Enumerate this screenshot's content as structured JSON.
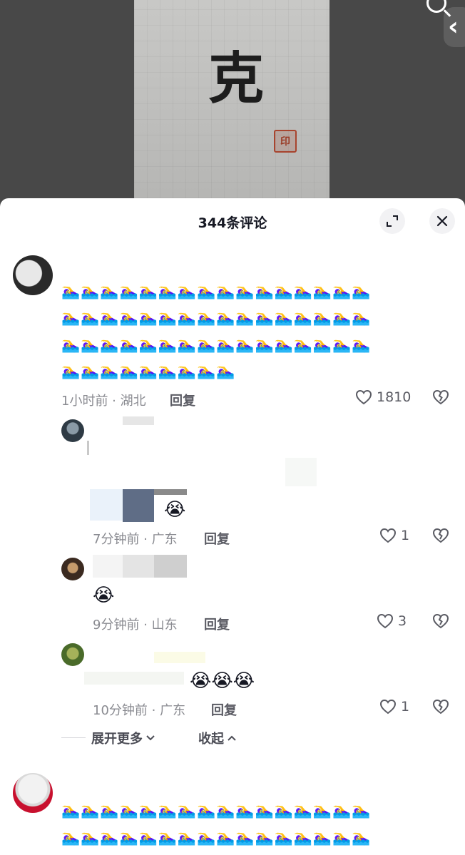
{
  "video": {
    "character": "克"
  },
  "header": {
    "title": "344条评论",
    "expand_icon": "expand-icon",
    "close_icon": "close-icon"
  },
  "comments": [
    {
      "emoji_rows": [
        "🏊‍♀️🏊‍♀️🏊‍♀️🏊‍♀️🏊‍♀️🏊‍♀️🏊‍♀️🏊‍♀️🏊‍♀️🏊‍♀️🏊‍♀️🏊‍♀️🏊‍♀️🏊‍♀️🏊‍♀️🏊‍♀️",
        "🏊‍♀️🏊‍♀️🏊‍♀️🏊‍♀️🏊‍♀️🏊‍♀️🏊‍♀️🏊‍♀️🏊‍♀️🏊‍♀️🏊‍♀️🏊‍♀️🏊‍♀️🏊‍♀️🏊‍♀️🏊‍♀️",
        "🏊‍♀️🏊‍♀️🏊‍♀️🏊‍♀️🏊‍♀️🏊‍♀️🏊‍♀️🏊‍♀️🏊‍♀️🏊‍♀️🏊‍♀️🏊‍♀️🏊‍♀️🏊‍♀️🏊‍♀️🏊‍♀️",
        "🏊‍♀️🏊‍♀️🏊‍♀️🏊‍♀️🏊‍♀️🏊‍♀️🏊‍♀️🏊‍♀️🏊‍♀️"
      ],
      "meta": "1小时前 · 湖北",
      "reply_label": "回复",
      "likes": "1810"
    }
  ],
  "replies": [
    {
      "text_suffix": "😭",
      "meta": "7分钟前 · 广东",
      "reply_label": "回复",
      "likes": "1"
    },
    {
      "text_suffix": "😭",
      "meta": "9分钟前 · 山东",
      "reply_label": "回复",
      "likes": "3"
    },
    {
      "text_suffix": "😭😭😭",
      "meta": "10分钟前 · 广东",
      "reply_label": "回复",
      "likes": "1"
    }
  ],
  "thread_controls": {
    "expand_more": "展开更多",
    "collapse": "收起"
  },
  "next_comment": {
    "emoji_rows": [
      "🏊‍♀️🏊‍♀️🏊‍♀️🏊‍♀️🏊‍♀️🏊‍♀️🏊‍♀️🏊‍♀️🏊‍♀️🏊‍♀️🏊‍♀️🏊‍♀️🏊‍♀️🏊‍♀️🏊‍♀️🏊‍♀️",
      "🏊‍♀️🏊‍♀️🏊‍♀️🏊‍♀️🏊‍♀️🏊‍♀️🏊‍♀️🏊‍♀️🏊‍♀️🏊‍♀️🏊‍♀️🏊‍♀️🏊‍♀️🏊‍♀️🏊‍♀️🏊‍♀️"
    ]
  }
}
